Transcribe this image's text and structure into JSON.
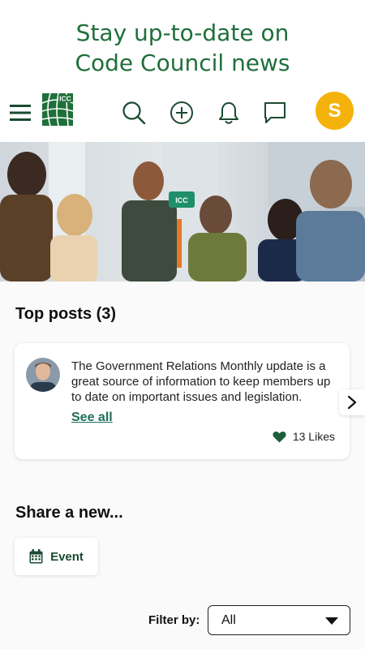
{
  "promo": {
    "line1": "Stay up-to-date on",
    "line2": "Code Council news"
  },
  "header": {
    "logo_text": "ICC",
    "avatar_initial": "S",
    "icons": [
      "menu-icon",
      "search-icon",
      "add-icon",
      "bell-icon",
      "chat-icon"
    ]
  },
  "hero": {
    "badge": "ICC"
  },
  "top_posts": {
    "title": "Top posts (3)",
    "post": {
      "text": "The Government Relations Monthly update is a great source of information to keep members up to date on important issues and legislation.",
      "see_all": "See all",
      "likes": "13 Likes"
    }
  },
  "share": {
    "title": "Share a new...",
    "event_label": "Event"
  },
  "filter": {
    "label": "Filter by:",
    "value": "All"
  },
  "colors": {
    "brand_green": "#1f6f3a",
    "accent_yellow": "#f5b20a",
    "link_teal": "#1f6f5a"
  }
}
